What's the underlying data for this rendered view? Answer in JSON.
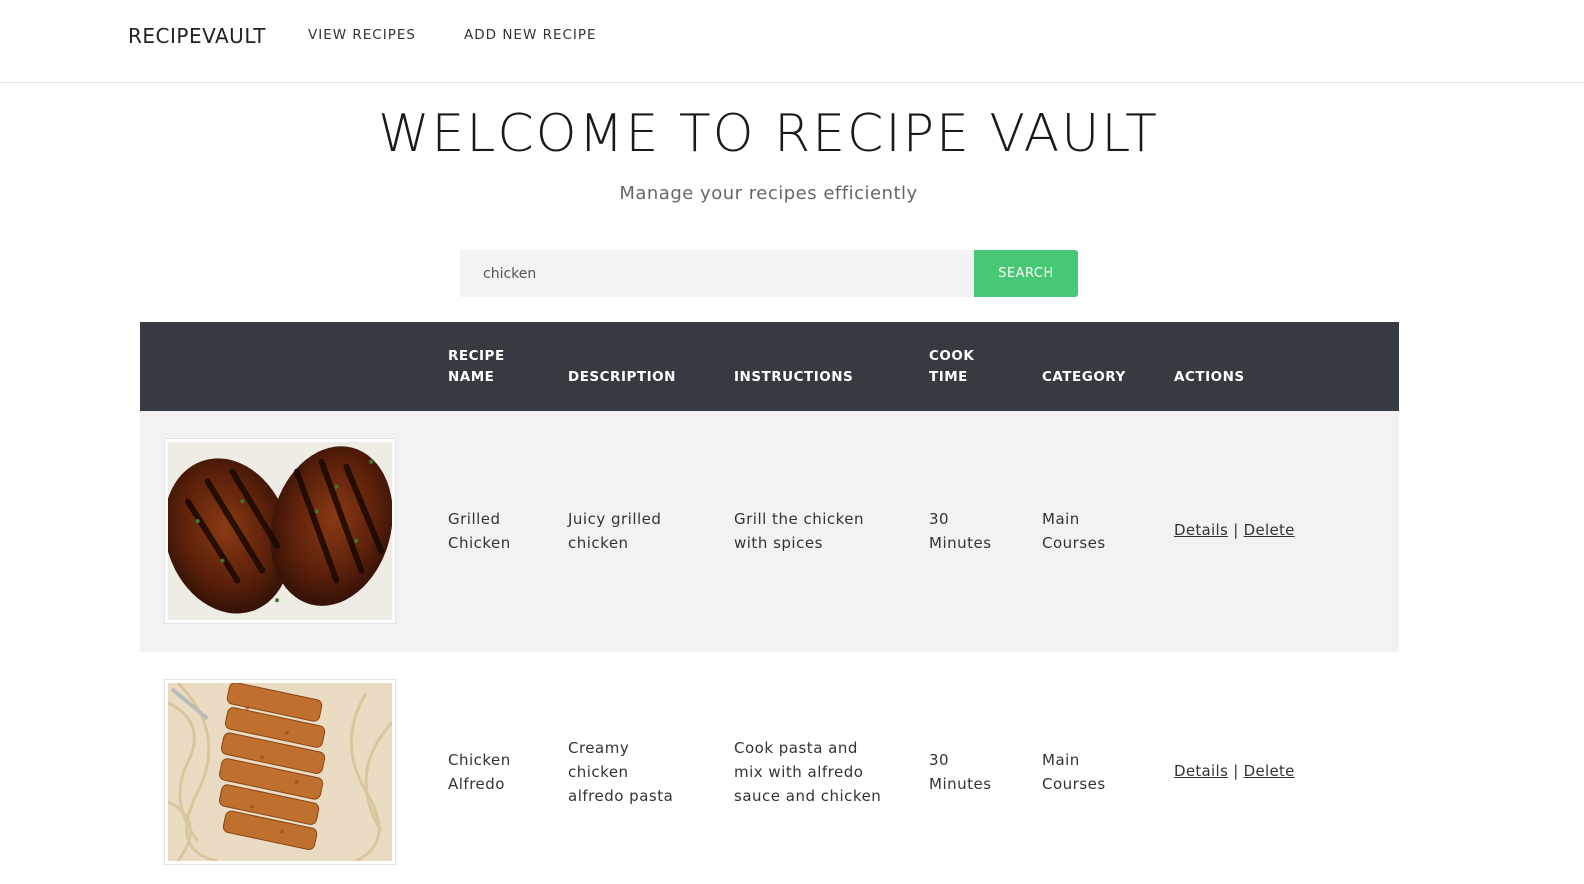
{
  "nav": {
    "brand": "RECIPEVAULT",
    "links": [
      "VIEW RECIPES",
      "ADD NEW RECIPE"
    ]
  },
  "hero": {
    "title": "WELCOME TO RECIPE VAULT",
    "subtitle": "Manage your recipes efficiently"
  },
  "search": {
    "value": "chicken",
    "button_label": "SEARCH",
    "button_color": "#48c774"
  },
  "table": {
    "header_bg": "#363b41",
    "headers": {
      "name": [
        "RECIPE",
        "NAME"
      ],
      "description": "DESCRIPTION",
      "instructions": "INSTRUCTIONS",
      "cook_time": [
        "COOK",
        "TIME"
      ],
      "category": "CATEGORY",
      "actions": "ACTIONS"
    },
    "rows": [
      {
        "image": "grilled-chicken-photo",
        "name": [
          "Grilled",
          "Chicken"
        ],
        "description": [
          "Juicy grilled",
          "chicken"
        ],
        "instructions": [
          "Grill the chicken",
          "with spices"
        ],
        "cook_time": [
          "30",
          "Minutes"
        ],
        "category": [
          "Main",
          "Courses"
        ],
        "details_label": "Details",
        "separator": "|",
        "delete_label": "Delete"
      },
      {
        "image": "chicken-alfredo-photo",
        "name": [
          "Chicken",
          "Alfredo"
        ],
        "description": [
          "Creamy",
          "chicken",
          "alfredo pasta"
        ],
        "instructions": [
          "Cook pasta and",
          "mix with alfredo",
          "sauce and chicken"
        ],
        "cook_time": [
          "30",
          "Minutes"
        ],
        "category": [
          "Main",
          "Courses"
        ],
        "details_label": "Details",
        "separator": "|",
        "delete_label": "Delete"
      }
    ]
  }
}
